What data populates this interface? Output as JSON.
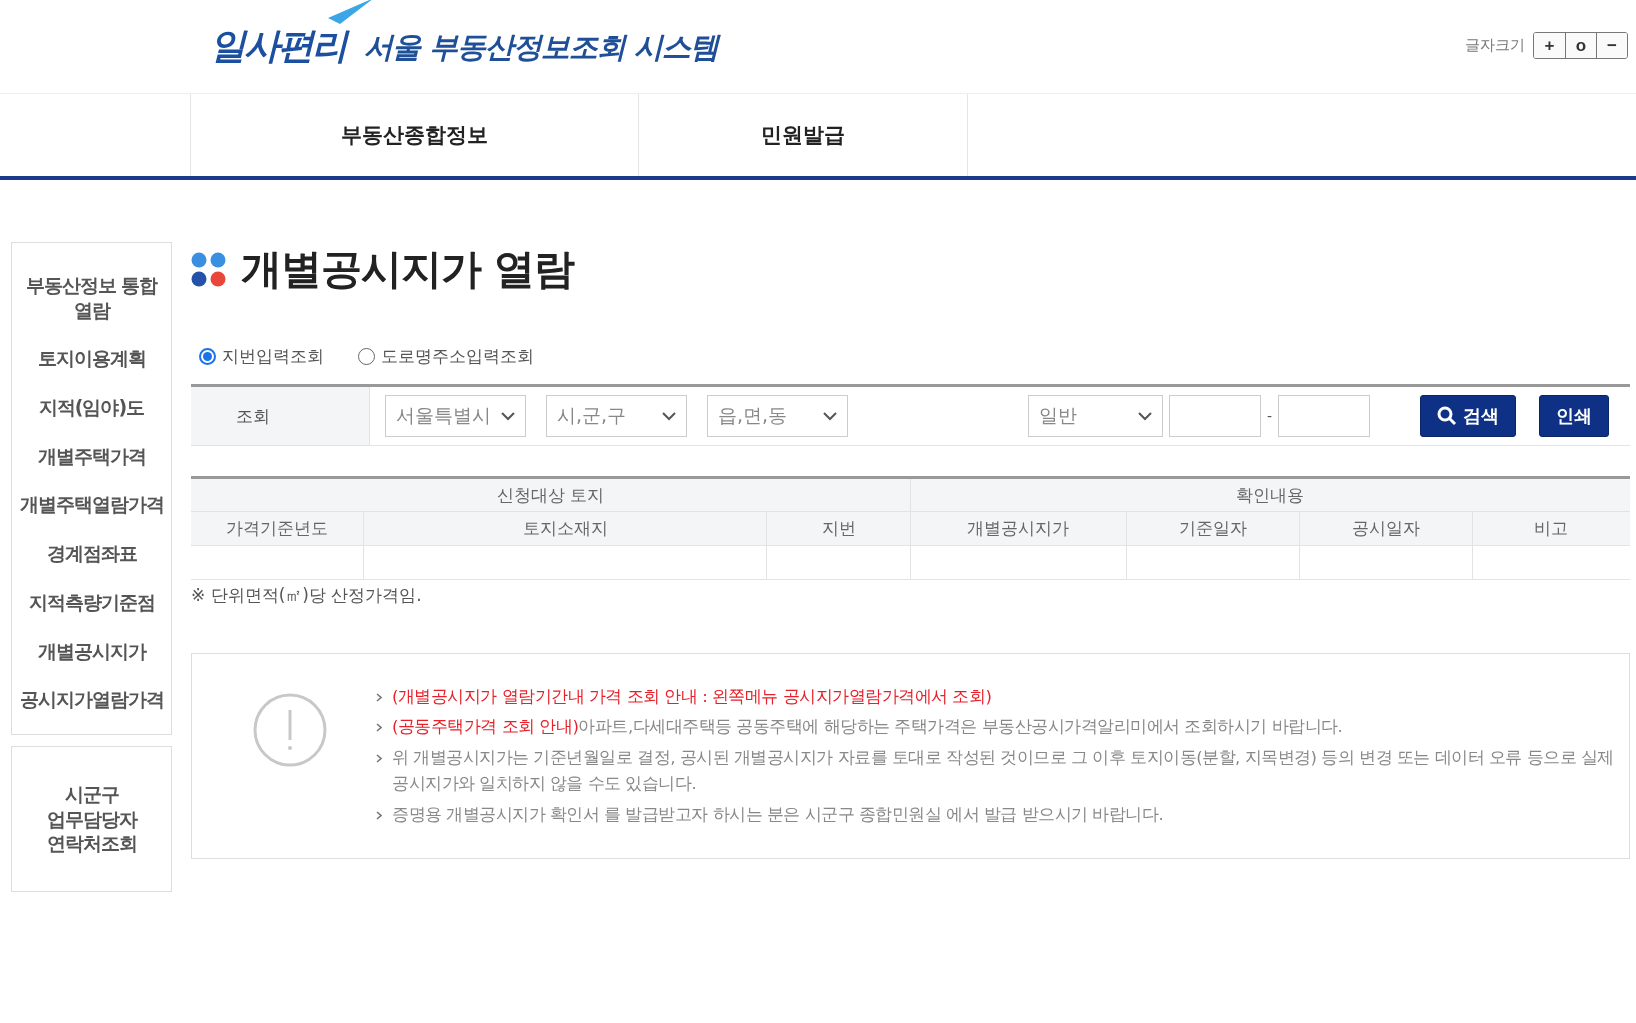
{
  "logo": {
    "brand": "일사편리",
    "title": "서울 부동산정보조회 시스템"
  },
  "font_size": {
    "label": "글자크기",
    "buttons": [
      "+",
      "o",
      "−"
    ]
  },
  "nav": [
    {
      "label": "부동산종합정보",
      "selected": false
    },
    {
      "label": "민원발급",
      "selected": false
    }
  ],
  "sidebar": {
    "items": [
      {
        "label": "부동산정보 통합 열람",
        "selected": false
      },
      {
        "label": "토지이용계획",
        "selected": false
      },
      {
        "label": "지적(임야)도",
        "selected": false
      },
      {
        "label": "개별주택가격",
        "selected": false
      },
      {
        "label": "개별주택열람가격",
        "selected": false
      },
      {
        "label": "경계점좌표",
        "selected": false
      },
      {
        "label": "지적측량기준점",
        "selected": false
      },
      {
        "label": "개별공시지가",
        "selected": false
      },
      {
        "label": "공시지가열람가격",
        "selected": false
      }
    ],
    "contact": "시군구\n업무담당자\n연락처조회"
  },
  "page_title": "개별공시지가 열람",
  "search_mode": [
    {
      "label": "지번입력조회",
      "selected": true
    },
    {
      "label": "도로명주소입력조회",
      "selected": false
    }
  ],
  "search": {
    "label": "조회",
    "selects": [
      "서울특별시",
      "시,군,구",
      "읍,면,동"
    ],
    "type_select": "일반",
    "separator": "-",
    "search_button": "검색",
    "print_button": "인쇄"
  },
  "table": {
    "groups": [
      "신청대상 토지",
      "확인내용"
    ],
    "columns": [
      "가격기준년도",
      "토지소재지",
      "지번",
      "개별공시지가",
      "기준일자",
      "공시일자",
      "비고"
    ]
  },
  "unit_note": "※ 단위면적(㎡)당 산정가격임.",
  "notice": [
    {
      "highlight": "(개별공시지가 열람기간내 가격 조회 안내 : 왼쪽메뉴 공시지가열람가격에서 조회)"
    },
    {
      "highlight": "(공동주택가격 조회 안내)",
      "text": "아파트,다세대주택등 공동주택에 해당하는 주택가격은 부동산공시가격알리미에서 조회하시기 바랍니다."
    },
    {
      "text": "위 개별공시지가는 기준년월일로 결정, 공시된 개별공시지가 자료를 토대로 작성된 것이므로 그 이후 토지이동(분할, 지목변경) 등의 변경 또는 데이터 오류 등으로 실제 공시지가와 일치하지 않을 수도 있습니다."
    },
    {
      "text": "증명용 개별공시지가 확인서 를 발급받고자 하시는 분은 시군구 종합민원실 에서 발급 받으시기 바랍니다."
    }
  ]
}
